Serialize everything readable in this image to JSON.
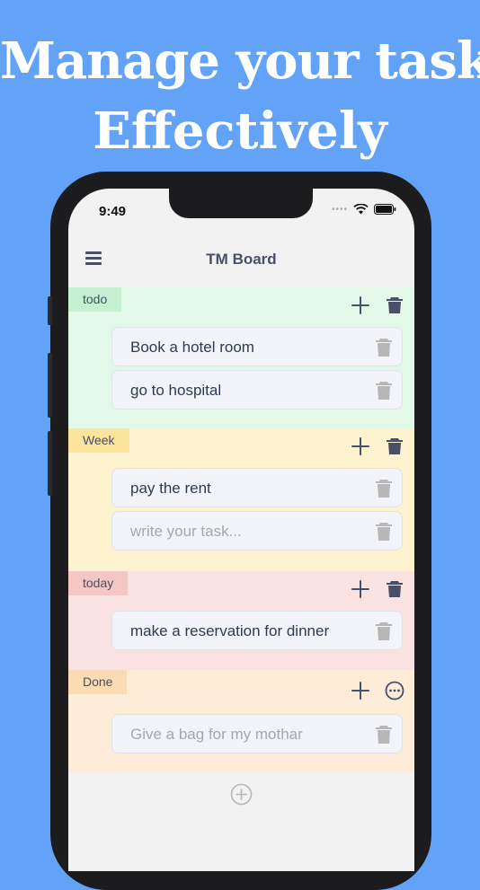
{
  "promo": {
    "line1": "Manage your task",
    "line2": "Effectively"
  },
  "status_bar": {
    "time": "9:49"
  },
  "header": {
    "title": "TM Board",
    "menu_icon": "hamburger-menu-icon"
  },
  "sections": [
    {
      "label": "todo",
      "bg": "#e3f8e9",
      "label_bg": "#c5f1d2",
      "actions": [
        "plus-icon",
        "trash-icon"
      ],
      "cards": [
        {
          "text": "Book a hotel room",
          "placeholder": false
        },
        {
          "text": "go to hospital",
          "placeholder": false
        }
      ]
    },
    {
      "label": "Week",
      "bg": "#fdf4cf",
      "label_bg": "#fbe49b",
      "actions": [
        "plus-icon",
        "trash-icon"
      ],
      "cards": [
        {
          "text": "pay the rent",
          "placeholder": false
        },
        {
          "text": "write your task...",
          "placeholder": true
        }
      ]
    },
    {
      "label": "today",
      "bg": "#f9e2e1",
      "label_bg": "#f5c6c6",
      "actions": [
        "plus-icon",
        "trash-icon"
      ],
      "cards": [
        {
          "text": "make a reservation for dinner",
          "placeholder": false
        }
      ]
    },
    {
      "label": "Done",
      "bg": "#fdecd8",
      "label_bg": "#fbdbb3",
      "actions": [
        "plus-icon",
        "more-icon"
      ],
      "cards": [
        {
          "text": "Give a bag for my mothar",
          "placeholder": true
        }
      ]
    }
  ],
  "add_column_icon": "plus-circle-icon",
  "colors": {
    "background": "#62a3f8",
    "text_primary": "#2f3b4f",
    "icon_dark": "#475066",
    "icon_muted": "#b7b7b7"
  }
}
